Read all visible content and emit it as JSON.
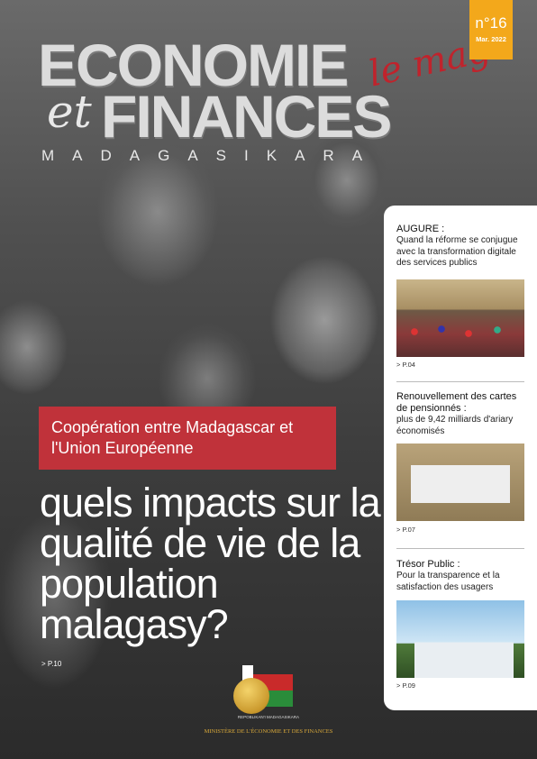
{
  "masthead": {
    "line1": "ECONOMIE",
    "et": "et",
    "line2": "FINANCES",
    "tagline": "le mag",
    "subtitle": "MADAGASIKARA"
  },
  "issue": {
    "number": "n°16",
    "date": "Mar. 2022"
  },
  "cover_story": {
    "kicker": "Coopération entre Madagascar et l'Union Européenne",
    "headline": "quels impacts sur la qualité de vie de la population malagasy?",
    "page_ref": "> P.10"
  },
  "sidebar": [
    {
      "heading": "AUGURE :",
      "desc": "Quand la réforme se conjugue avec la transformation digitale des services publics",
      "page_ref": "> P.04",
      "image_label": "conference room"
    },
    {
      "heading": "Renouvellement des cartes de pensionnés :",
      "desc": "plus de 9,42 milliards d'ariary économisés",
      "page_ref": "> P.07",
      "image_label": "stack of cards"
    },
    {
      "heading": "Trésor Public :",
      "desc": "Pour la transparence et la satisfaction des usagers",
      "page_ref": "> P.09",
      "image_label": "building"
    }
  ],
  "footer": {
    "republic": "REPOBLIKAN'I MADAGASIKARA",
    "ministry": "MINISTÈRE DE L'ÉCONOMIE ET DES FINANCES"
  },
  "colors": {
    "accent_red": "#c0323a",
    "issue_orange": "#f3a81b",
    "ministry_gold": "#d9a93a"
  }
}
